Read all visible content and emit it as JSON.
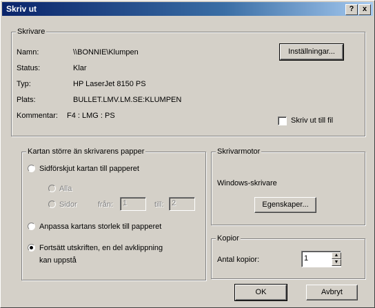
{
  "window": {
    "title": "Skriv ut",
    "help_label": "?",
    "close_label": "x"
  },
  "printer": {
    "group_label": "Skrivare",
    "name_label": "Namn:",
    "name_value": "\\\\BONNIE\\Klumpen",
    "status_label": "Status:",
    "status_value": "Klar",
    "type_label": "Typ:",
    "type_value": "HP LaserJet 8150 PS",
    "location_label": "Plats:",
    "location_value": "BULLET.LMV.LM.SE:KLUMPEN",
    "comment_label": "Kommentar:",
    "comment_value": "F4 : LMG : PS",
    "settings_button": "Inställningar...",
    "print_to_file_label": "Skriv ut till fil",
    "print_to_file_checked": false
  },
  "paper": {
    "group_label": "Kartan större än skrivarens papper",
    "option_shift": "Sidförskjut kartan till papperet",
    "sub_all": "Alla",
    "sub_pages": "Sidor",
    "from_label": "från:",
    "from_value": "1",
    "to_label": "till:",
    "to_value": "2",
    "option_fit": "Anpassa kartans storlek till papperet",
    "option_continue_line1": "Fortsätt utskriften, en del avklippning",
    "option_continue_line2": "kan uppstå",
    "selected": "continue"
  },
  "engine": {
    "group_label": "Skrivarmotor",
    "value": "Windows-skrivare",
    "properties_button": "Egenskaper..."
  },
  "copies": {
    "group_label": "Kopior",
    "count_label": "Antal kopior:",
    "count_value": "1"
  },
  "buttons": {
    "ok": "OK",
    "cancel": "Avbryt"
  }
}
